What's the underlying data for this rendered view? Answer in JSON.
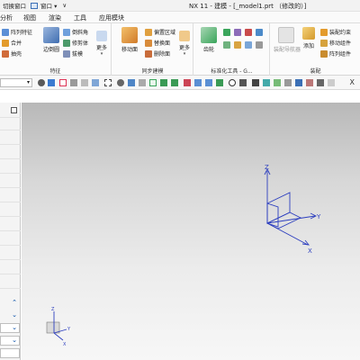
{
  "titlebar": {
    "left_items": [
      "切换窗口",
      "窗口 ▾",
      "∨"
    ],
    "window_title": "NX 11 - 建模 - [_model1.prt （修改的）]"
  },
  "menubar": {
    "items": [
      "分析",
      "视图",
      "渲染",
      "工具",
      "应用模块"
    ]
  },
  "ribbon": {
    "feature_group": {
      "label": "特征",
      "buttons": [
        "阵列特征",
        "合并",
        "抽壳",
        "边倒圆",
        "倒斜角",
        "修剪体",
        "拔模",
        "更多"
      ]
    },
    "sync_group": {
      "label": "同步建模",
      "buttons": [
        "移动面",
        "偏置区域",
        "替换面",
        "删除面",
        "更多"
      ]
    },
    "standard_group": {
      "label": "标准化工具 - G...",
      "buttons": [
        "齿轮"
      ]
    },
    "assembly_group": {
      "label": "装配",
      "buttons": [
        "装配导航器",
        "添加",
        "装配约束",
        "移动组件",
        "阵列组件"
      ]
    },
    "colors": {
      "accent": "#2f6fc6",
      "orange": "#e39b2c",
      "green": "#3aa55b"
    }
  },
  "toolrow": {
    "close_label": "X"
  },
  "viewport": {
    "axes_main": {
      "z": "Z",
      "y": "Y",
      "x": "X"
    },
    "axes_triad": {
      "z": "Z",
      "y": "Y",
      "x": "X"
    },
    "icons": [
      "datum-csys-icon",
      "view-triad-icon"
    ]
  }
}
